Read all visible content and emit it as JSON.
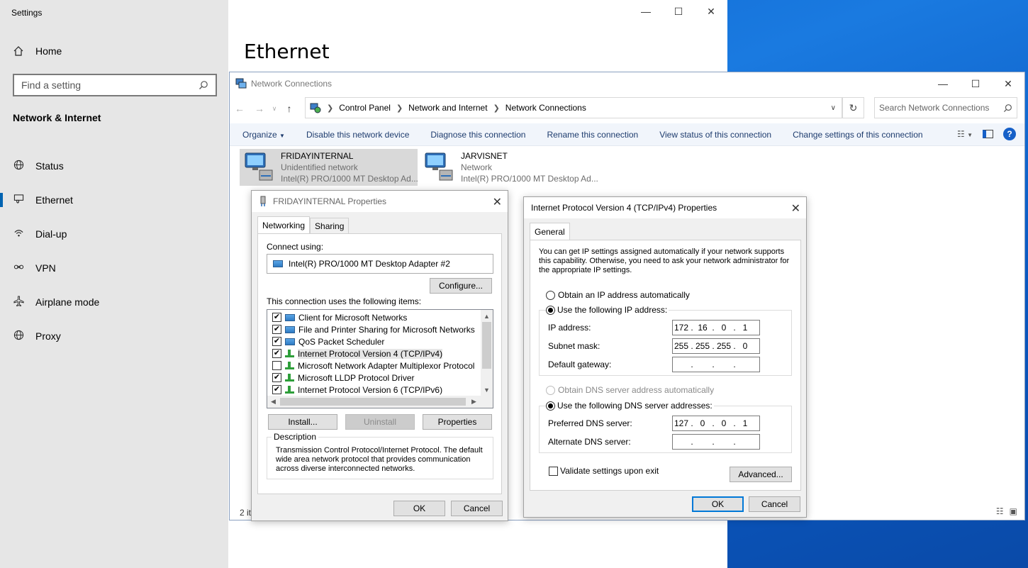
{
  "settings": {
    "window_title": "Settings",
    "home_label": "Home",
    "search_placeholder": "Find a setting",
    "section_title": "Network & Internet",
    "nav_items": [
      {
        "label": "Status",
        "icon": "globe-icon"
      },
      {
        "label": "Ethernet",
        "icon": "ethernet-icon"
      },
      {
        "label": "Dial-up",
        "icon": "dialup-icon"
      },
      {
        "label": "VPN",
        "icon": "vpn-icon"
      },
      {
        "label": "Airplane mode",
        "icon": "airplane-icon"
      },
      {
        "label": "Proxy",
        "icon": "globe-icon"
      }
    ],
    "selected_nav": "Ethernet",
    "page_title": "Ethernet"
  },
  "netconn": {
    "window_title": "Network Connections",
    "breadcrumb": [
      "Control Panel",
      "Network and Internet",
      "Network Connections"
    ],
    "search_placeholder": "Search Network Connections",
    "commands": [
      "Organize",
      "Disable this network device",
      "Diagnose this connection",
      "Rename this connection",
      "View status of this connection",
      "Change settings of this connection"
    ],
    "connections": [
      {
        "name": "FRIDAYINTERNAL",
        "status": "Unidentified network",
        "adapter": "Intel(R) PRO/1000 MT Desktop Ad..."
      },
      {
        "name": "JARVISNET",
        "status": "Network",
        "adapter": "Intel(R) PRO/1000 MT Desktop Ad..."
      }
    ],
    "item_count": "2 it"
  },
  "props": {
    "title": "FRIDAYINTERNAL Properties",
    "tabs": [
      "Networking",
      "Sharing"
    ],
    "connect_using_label": "Connect using:",
    "adapter": "Intel(R) PRO/1000 MT Desktop Adapter #2",
    "configure_label": "Configure...",
    "items_label": "This connection uses the following items:",
    "items": [
      {
        "label": "Client for Microsoft Networks",
        "checked": true,
        "icon": "network-client-icon"
      },
      {
        "label": "File and Printer Sharing for Microsoft Networks",
        "checked": true,
        "icon": "network-service-icon"
      },
      {
        "label": "QoS Packet Scheduler",
        "checked": true,
        "icon": "network-service-icon"
      },
      {
        "label": "Internet Protocol Version 4 (TCP/IPv4)",
        "checked": true,
        "icon": "protocol-icon"
      },
      {
        "label": "Microsoft Network Adapter Multiplexor Protocol",
        "checked": false,
        "icon": "protocol-icon"
      },
      {
        "label": "Microsoft LLDP Protocol Driver",
        "checked": true,
        "icon": "protocol-icon"
      },
      {
        "label": "Internet Protocol Version 6 (TCP/IPv6)",
        "checked": true,
        "icon": "protocol-icon"
      }
    ],
    "install_label": "Install...",
    "uninstall_label": "Uninstall",
    "properties_label": "Properties",
    "description_title": "Description",
    "description_text": "Transmission Control Protocol/Internet Protocol. The default wide area network protocol that provides communication across diverse interconnected networks.",
    "ok_label": "OK",
    "cancel_label": "Cancel"
  },
  "ipv4": {
    "title": "Internet Protocol Version 4 (TCP/IPv4) Properties",
    "tab": "General",
    "intro": "You can get IP settings assigned automatically if your network supports this capability. Otherwise, you need to ask your network administrator for the appropriate IP settings.",
    "auto_ip_label": "Obtain an IP address automatically",
    "manual_ip_label": "Use the following IP address:",
    "ip_label": "IP address:",
    "ip": [
      "172",
      "16",
      "0",
      "1"
    ],
    "mask_label": "Subnet mask:",
    "mask": [
      "255",
      "255",
      "255",
      "0"
    ],
    "gateway_label": "Default gateway:",
    "gateway": [
      "",
      "",
      "",
      ""
    ],
    "auto_dns_label": "Obtain DNS server address automatically",
    "manual_dns_label": "Use the following DNS server addresses:",
    "pref_dns_label": "Preferred DNS server:",
    "pref_dns": [
      "127",
      "0",
      "0",
      "1"
    ],
    "alt_dns_label": "Alternate DNS server:",
    "alt_dns": [
      "",
      "",
      "",
      ""
    ],
    "validate_label": "Validate settings upon exit",
    "advanced_label": "Advanced...",
    "ok_label": "OK",
    "cancel_label": "Cancel"
  }
}
